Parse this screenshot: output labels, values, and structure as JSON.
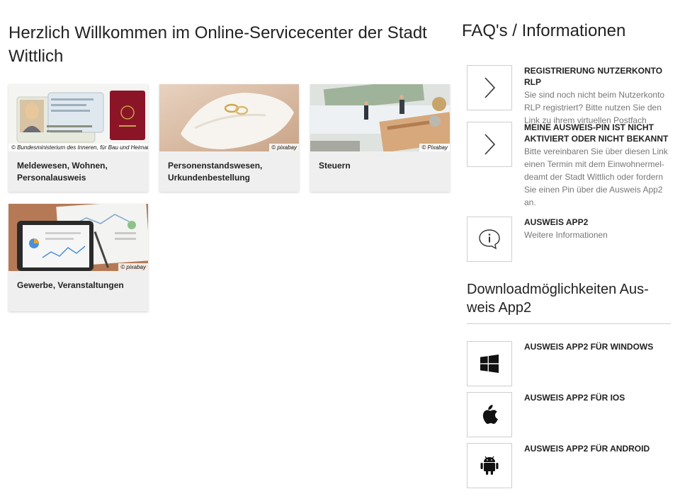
{
  "main": {
    "title": "Herzlich Willkommen im Online-Servicecenter der Stadt Wittlich",
    "tiles": [
      {
        "label": "Meldewesen, Wohnen, Personalausweis",
        "credit": "© Bundesministerium des Inneren, für Bau und Heimat"
      },
      {
        "label": "Personenstandswesen, Urkundenbestellung",
        "credit": "© pixabay"
      },
      {
        "label": "Steuern",
        "credit": "© Pixabay"
      },
      {
        "label": "Gewerbe, Veranstaltungen",
        "credit": "© pixabay"
      }
    ]
  },
  "sidebar": {
    "faq_title": "FAQ's / Informationen",
    "faq_items": [
      {
        "title": "Registrierung Nutzerkonto RLP",
        "text": "Sie sind noch nicht beim Nutzerkonto RLP registriert? Bitte nutzen Sie den Link zu ihrem virtuellen Postfach",
        "icon": "chevron-right-icon"
      },
      {
        "title": "Meine Ausweis-PIN ist nicht ak­tiviert oder nicht bekannt",
        "text": "Bitte vereinbaren Sie über diesen Link einen Termin mit dem Einwohnermel­deamt der Stadt Wittlich oder fordern Sie einen Pin über die Ausweis App2 an.",
        "icon": "chevron-right-icon"
      },
      {
        "title": "Ausweis App2",
        "text": "Weitere Informationen",
        "icon": "info-bubble-icon"
      }
    ],
    "download_title": "Downloadmöglichkeiten Aus­weis App2",
    "downloads": [
      {
        "title": "Ausweis App2 für Windows",
        "icon": "windows-icon"
      },
      {
        "title": "Ausweis App2 für iOS",
        "icon": "apple-icon"
      },
      {
        "title": "Ausweis App2 für Android",
        "icon": "android-icon"
      }
    ]
  }
}
